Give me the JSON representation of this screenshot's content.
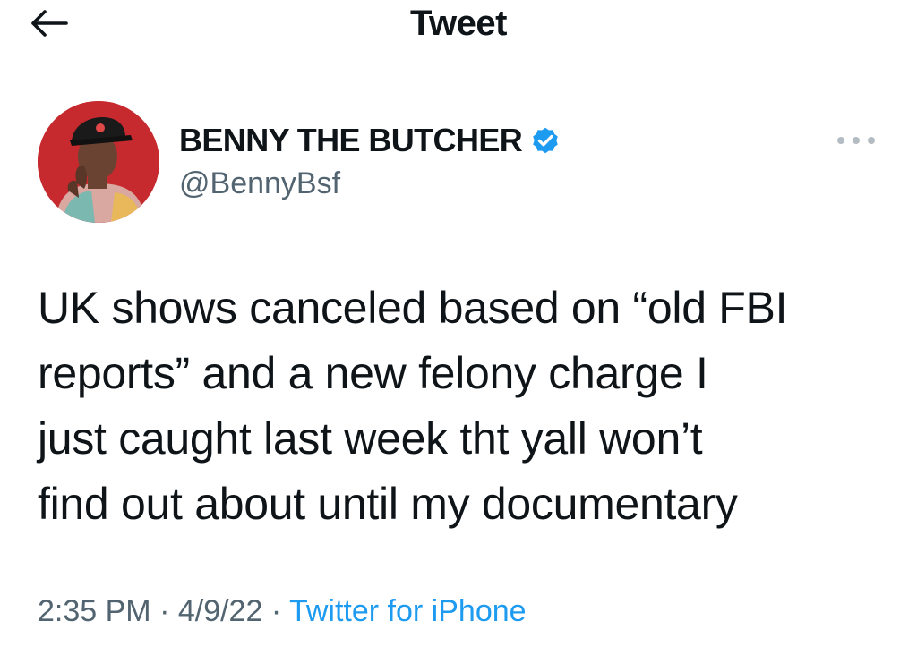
{
  "header": {
    "title": "Tweet",
    "back_icon": "arrow-left-icon"
  },
  "author": {
    "display_name": "BENNY THE BUTCHER",
    "handle": "@BennyBsf",
    "verified": true,
    "verified_color": "#1d9bf0"
  },
  "tweet": {
    "text": "UK shows canceled based on “old FBI\nreports” and a new felony charge I\njust caught last week tht yall won’t\nfind out about until my documentary",
    "time": "2:35 PM",
    "date": "4/9/22",
    "separator": " · ",
    "source": "Twitter for iPhone"
  },
  "colors": {
    "text_primary": "#0f1419",
    "text_secondary": "#536471",
    "link": "#1d9bf0"
  }
}
